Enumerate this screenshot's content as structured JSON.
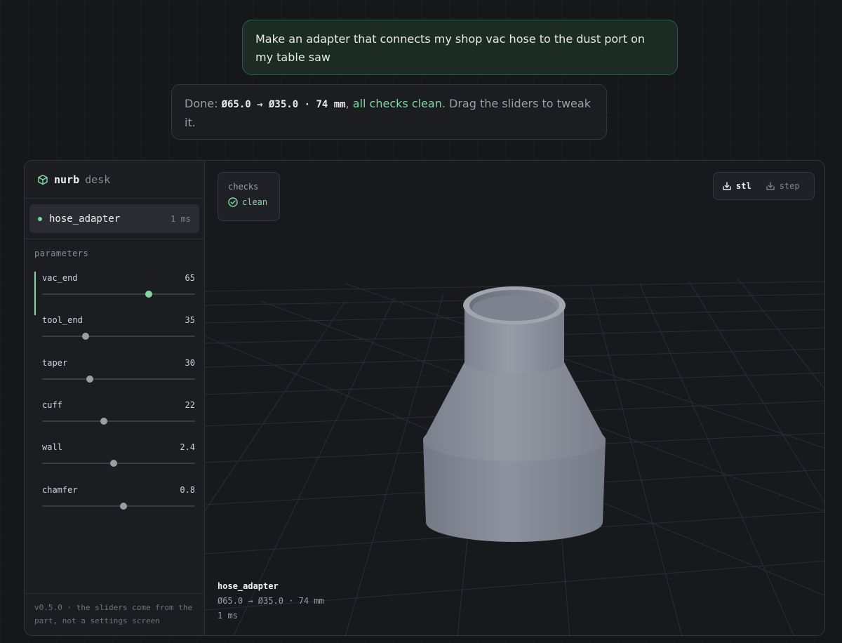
{
  "chat": {
    "user_message": "Make an adapter that connects my shop vac hose to the dust port on my table saw",
    "ai_prefix": "Done: ",
    "ai_spec": "Ø65.0 → Ø35.0 · 74 mm",
    "ai_comma": ", ",
    "ai_status": "all checks clean",
    "ai_suffix": ". Drag the sliders to tweak it."
  },
  "sidebar": {
    "brand_name": "nurb",
    "brand_sub": "desk",
    "part": {
      "name": "hose_adapter",
      "time": "1 ms"
    },
    "params_title": "parameters",
    "params": [
      {
        "name": "vac_end",
        "value": "65",
        "fraction": 0.695
      },
      {
        "name": "tool_end",
        "value": "35",
        "fraction": 0.285
      },
      {
        "name": "taper",
        "value": "30",
        "fraction": 0.31
      },
      {
        "name": "cuff",
        "value": "22",
        "fraction": 0.405
      },
      {
        "name": "wall",
        "value": "2.4",
        "fraction": 0.468
      },
      {
        "name": "chamfer",
        "value": "0.8",
        "fraction": 0.53
      }
    ],
    "footer_note": "v0.5.0 · the sliders come from the part, not a settings screen"
  },
  "viewport": {
    "checks_title": "checks",
    "checks_status": "clean",
    "export_stl": "stl",
    "export_step": "step",
    "info_name": "hose_adapter",
    "info_dims": "Ø65.0 → Ø35.0 · 74 mm",
    "info_time": "1 ms"
  },
  "colors": {
    "accent": "#7fd6a0",
    "background": "#16171b",
    "panel": "#1c1d21",
    "model": "#8b919c"
  }
}
